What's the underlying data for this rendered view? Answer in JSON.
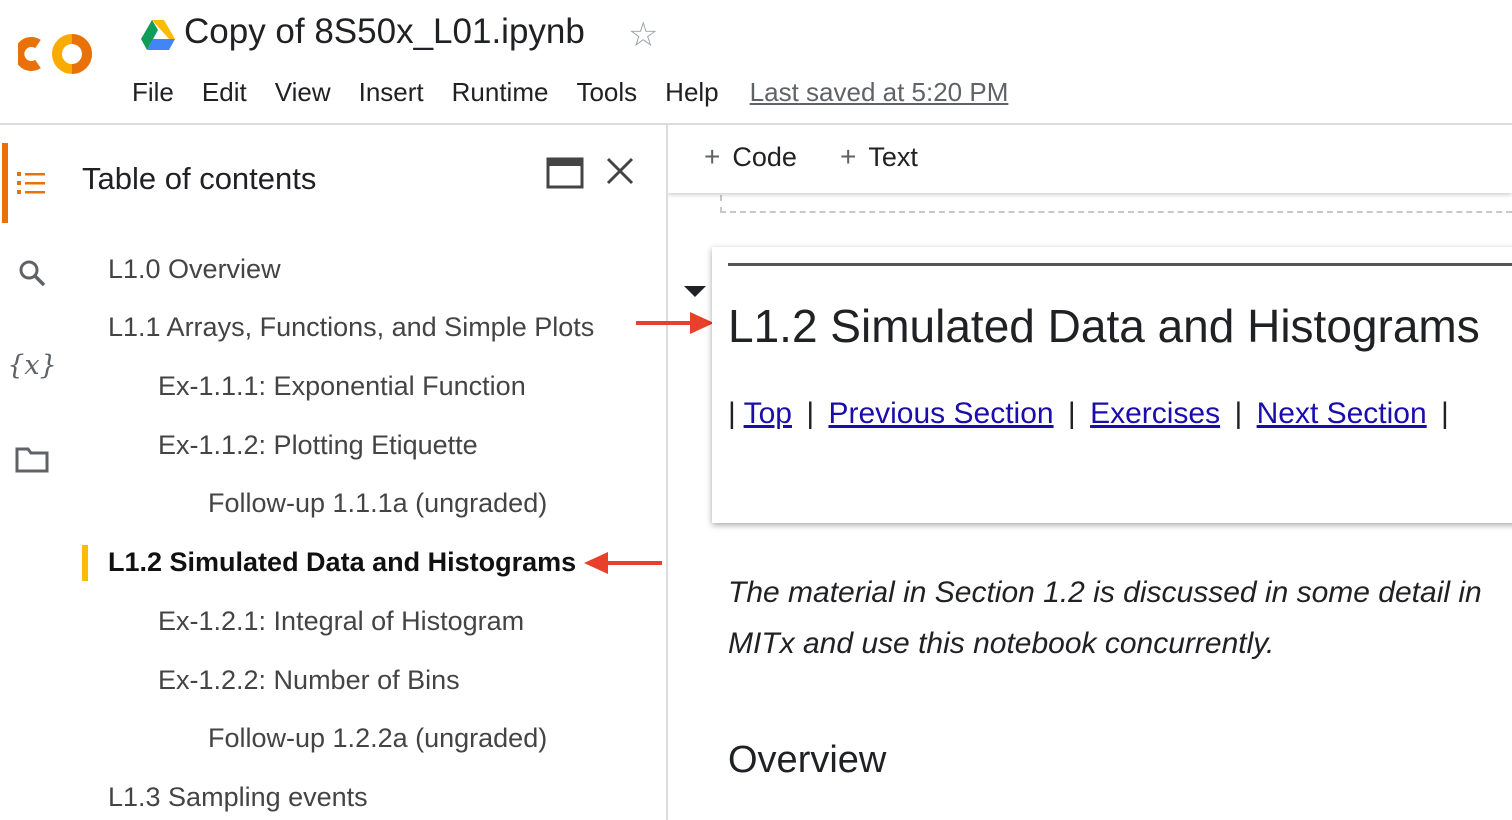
{
  "header": {
    "doc_title": "Copy of 8S50x_L01.ipynb",
    "menu": [
      "File",
      "Edit",
      "View",
      "Insert",
      "Runtime",
      "Tools",
      "Help"
    ],
    "last_saved": "Last saved at 5:20 PM"
  },
  "rail": {
    "icons": [
      "toc-list-icon",
      "search-icon",
      "variables-icon",
      "folder-icon"
    ],
    "variables_glyph": "{x}"
  },
  "toc": {
    "title": "Table of contents",
    "items": [
      {
        "label": "L1.0 Overview",
        "level": 1
      },
      {
        "label": "L1.1 Arrays, Functions, and Simple Plots",
        "level": 1
      },
      {
        "label": "Ex-1.1.1: Exponential Function",
        "level": 2
      },
      {
        "label": "Ex-1.1.2: Plotting Etiquette",
        "level": 2
      },
      {
        "label": "Follow-up 1.1.1a (ungraded)",
        "level": 3
      },
      {
        "label": "L1.2 Simulated Data and Histograms",
        "level": 1,
        "active": true
      },
      {
        "label": "Ex-1.2.1: Integral of Histogram",
        "level": 2
      },
      {
        "label": "Ex-1.2.2: Number of Bins",
        "level": 2
      },
      {
        "label": "Follow-up 1.2.2a (ungraded)",
        "level": 3
      },
      {
        "label": "L1.3 Sampling events",
        "level": 1
      }
    ]
  },
  "toolbar": {
    "code_label": "Code",
    "text_label": "Text",
    "plus_glyph": "+"
  },
  "notebook": {
    "heading": "L1.2 Simulated Data and Histograms",
    "links": [
      "Top",
      "Previous Section",
      "Exercises",
      "Next Section"
    ],
    "separator": "|",
    "paragraph_line1": "The material in Section 1.2 is discussed in some detail in",
    "paragraph_line2": "MITx and use this notebook concurrently.",
    "overview_heading": "Overview"
  },
  "colors": {
    "accent_orange": "#e8710a",
    "active_yellow": "#fbbc04",
    "annotation_red": "#e8402a",
    "link_blue": "#1a0dab"
  }
}
